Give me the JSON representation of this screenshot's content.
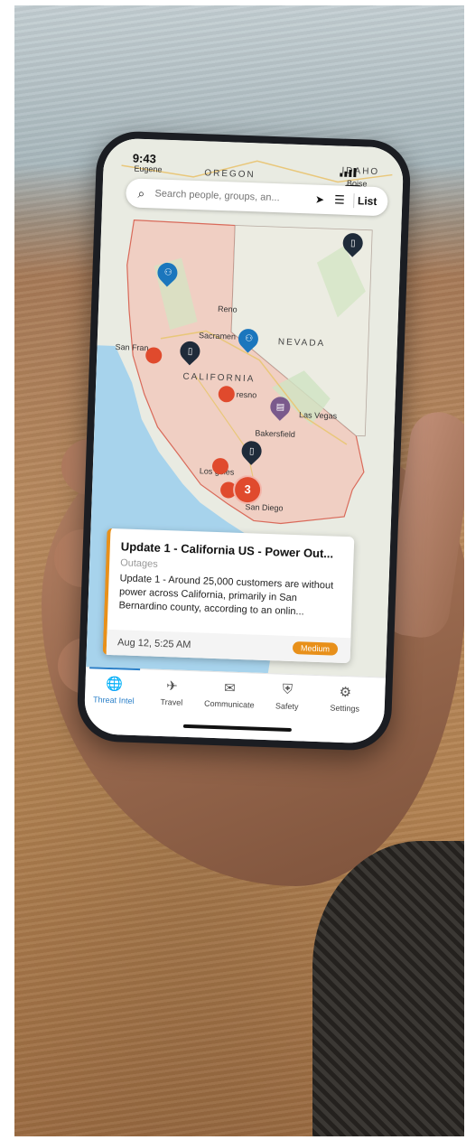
{
  "status_bar": {
    "time": "9:43"
  },
  "search": {
    "placeholder": "Search people, groups, an...",
    "list_label": "List"
  },
  "map_labels": {
    "eugene": "Eugene",
    "oregon": "OREGON",
    "idaho": "IDAHO",
    "boise": "Boise",
    "reno": "Reno",
    "sacramento": "Sacramen",
    "san_francisco": "San Fran",
    "nevada": "NEVADA",
    "california": "CALIFORNIA",
    "fresno": "resno",
    "las_vegas": "Las Vegas",
    "bakersfield": "Bakersfield",
    "los_angeles": "Los geles",
    "san_diego": "San Diego"
  },
  "cluster_count": "3",
  "alert_card": {
    "title": "Update 1 - California US - Power Out...",
    "category": "Outages",
    "body": "Update 1 - Around 25,000 customers are without power across California, primarily in San Bernardino county, according to an onlin...",
    "date": "Aug 12, 5:25 AM",
    "severity": "Medium"
  },
  "tabs": [
    {
      "label": "Threat Intel",
      "icon": "globe-icon",
      "active": true
    },
    {
      "label": "Travel",
      "icon": "plane-icon",
      "active": false
    },
    {
      "label": "Communicate",
      "icon": "chat-icon",
      "active": false
    },
    {
      "label": "Safety",
      "icon": "shield-icon",
      "active": false
    },
    {
      "label": "Settings",
      "icon": "gear-icon",
      "active": false
    }
  ],
  "colors": {
    "accent": "#2a7fc8",
    "alert_red": "#e04a2d",
    "severity_orange": "#e8901a",
    "pin_dark": "#1f2b3a",
    "pin_blue": "#1b76bd",
    "pin_purple": "#7a5a8c"
  }
}
